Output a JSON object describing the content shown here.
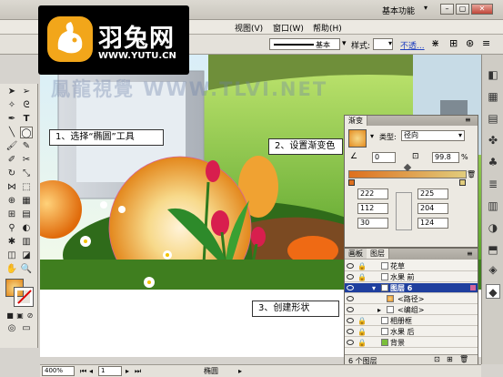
{
  "logo": {
    "name": "羽兔网",
    "url": "WWW.YUTU.CN"
  },
  "titlebar": {
    "workspace": "基本功能"
  },
  "menu": {
    "view": "视图(V)",
    "window": "窗口(W)",
    "help": "帮助(H)"
  },
  "control": {
    "stroke_label": "基本",
    "style_label": "样式:",
    "opacity_label": "不透..."
  },
  "watermark": "鳳龍視覺 WWW.TLVI.NET",
  "callouts": {
    "step1": "1、选择“椭圆”工具",
    "step2": "2、设置渐变色",
    "step3": "3、创建形状"
  },
  "gradient_panel": {
    "tab": "渐变",
    "type_label": "类型:",
    "type_value": "径向",
    "angle_value": "0",
    "ratio_value": "99.8",
    "percent": "%",
    "left_rgb": [
      "222",
      "112",
      "30"
    ],
    "right_rgb": [
      "225",
      "204",
      "124"
    ],
    "colors": {
      "start": "#f7d98a",
      "end": "#e38a1e"
    }
  },
  "layers_panel": {
    "tabs": [
      "画板",
      "图层"
    ],
    "layers": [
      "花草",
      "水果 前",
      "图层 6",
      "<路径>",
      "<编组>",
      "相册框",
      "水果 后",
      "背景"
    ],
    "count": "6 个图层"
  },
  "status": {
    "zoom": "400%",
    "page": "1",
    "tool": "椭圆"
  },
  "colors": {
    "selection": "#1f3f9e",
    "accent": "#f08c1a",
    "canvas_bg": "#ffffff"
  }
}
